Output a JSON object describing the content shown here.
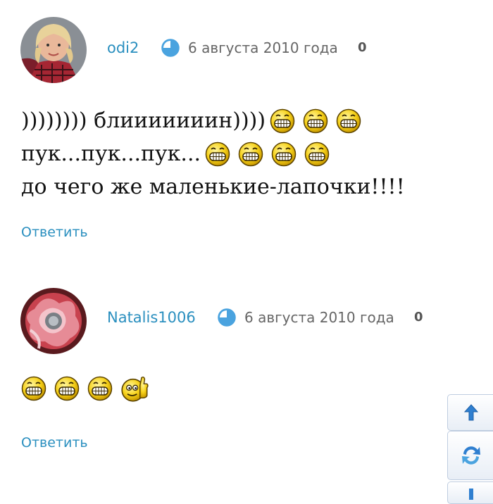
{
  "comments": [
    {
      "author": "odi2",
      "date": "6 августа 2010 года",
      "rating": "0",
      "lines": [
        {
          "text": ")))))))) блииииииин))))",
          "emoji_count": 3
        },
        {
          "text": "пук...пук...пук...",
          "emoji_count": 4
        },
        {
          "text": "до чего же маленькие-лапочки!!!!",
          "emoji_count": 0
        }
      ],
      "reply_label": "Ответить"
    },
    {
      "author": "Natalis1006",
      "date": "6 августа 2010 года",
      "rating": "0",
      "emojis": [
        "grin",
        "grin",
        "grin",
        "thumbs-up"
      ],
      "reply_label": "Ответить"
    }
  ],
  "icons": {
    "clock": "clock-icon",
    "emoji": "grin-emoji-icon",
    "thumbs": "thumbs-up-emoji-icon",
    "scroll_up": "arrow-up-icon",
    "refresh": "refresh-icon",
    "scroll_down": "arrow-down-icon"
  },
  "colors": {
    "link": "#2a8fbf",
    "clock": "#4aa3df",
    "emoji_yellow": "#f7d21a"
  }
}
